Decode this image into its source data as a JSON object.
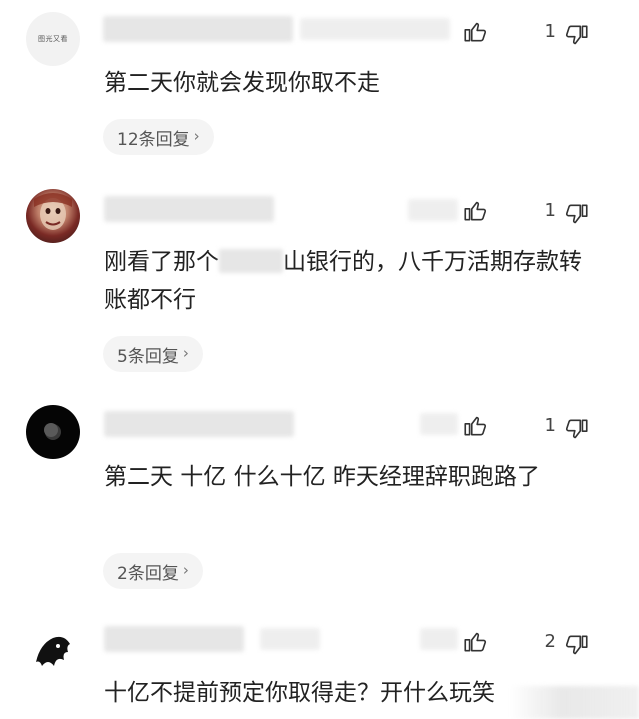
{
  "comments": [
    {
      "avatar_text": "图光又看",
      "text": "第二天你就会发现你取不走",
      "text_before_blur": "",
      "text_after_blur": "",
      "like_count": "1",
      "replies_label": "12条回复"
    },
    {
      "text_before_blur": "刚看了那个",
      "text_after_blur": "山银行的，八千万活期存款转账都不行",
      "like_count": "1",
      "replies_label": "5条回复"
    },
    {
      "text": "第二天 十亿 什么十亿 昨天经理辞职跑路了",
      "like_count": "1",
      "replies_label": "2条回复"
    },
    {
      "text": "十亿不提前预定你取得走？开什么玩笑",
      "like_count": "2"
    }
  ],
  "icons": {
    "like": "thumbs-up-icon",
    "dislike": "thumbs-down-icon",
    "chevron": "chevron-right-icon"
  },
  "colors": {
    "text": "#222222",
    "secondary": "#555555",
    "chip_bg": "#f4f4f4"
  }
}
